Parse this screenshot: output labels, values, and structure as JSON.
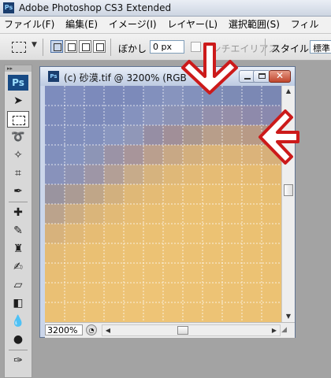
{
  "app": {
    "badge": "Ps",
    "title": "Adobe Photoshop CS3 Extended"
  },
  "menu": [
    "ファイル(F)",
    "編集(E)",
    "イメージ(I)",
    "レイヤー(L)",
    "選択範囲(S)",
    "フィル"
  ],
  "options": {
    "feather_label": "ぼかし :",
    "feather_value": "0 px",
    "antialias_label": "アンチエイリアス",
    "style_label": "スタイル :",
    "style_value": "標準"
  },
  "toolbox": {
    "logo": "Ps"
  },
  "document": {
    "badge": "Ps",
    "title": "(c) 砂漠.tif @ 3200% (RGB",
    "zoom": "3200%",
    "grid_colors": [
      [
        "#7d8cbd",
        "#7f8dbe",
        "#7c8abb",
        "#7b89ba",
        "#7c8aba",
        "#8290bd",
        "#8794be",
        "#8391bc",
        "#7f8db7",
        "#7d8bb5",
        "#7b88b4",
        "#7a87b3"
      ],
      [
        "#7e8cbc",
        "#7f8dbc",
        "#7c8aba",
        "#7e8cbb",
        "#8592be",
        "#8c96bd",
        "#8c93b6",
        "#8b90b2",
        "#938fac",
        "#958ea9",
        "#8e8aab",
        "#8a89ae"
      ],
      [
        "#7f8dbc",
        "#808ebc",
        "#8290bd",
        "#8996bf",
        "#9097b8",
        "#968ea4",
        "#a18f98",
        "#aa978f",
        "#b89e8a",
        "#bb9e86",
        "#b89a86",
        "#ad9387"
      ],
      [
        "#8290bd",
        "#8694bf",
        "#8d95b6",
        "#9b93a6",
        "#a8959a",
        "#ba9f8e",
        "#c8a885",
        "#d3af7d",
        "#dbb479",
        "#dcb478",
        "#dbb37a",
        "#d7b07a"
      ],
      [
        "#8892bb",
        "#8f93b3",
        "#9e96a6",
        "#b39f96",
        "#c7ab8a",
        "#d6b37e",
        "#dfb878",
        "#e3ba76",
        "#e6bc74",
        "#e7bc73",
        "#e6bb72",
        "#e5ba72"
      ],
      [
        "#9a949f",
        "#ab9b94",
        "#c0a688",
        "#d2b07e",
        "#dfb877",
        "#e4bb75",
        "#e7bd74",
        "#e9bf73",
        "#eac073",
        "#eabf72",
        "#e9bf72",
        "#e8be71"
      ],
      [
        "#bba38c",
        "#cdad82",
        "#dab57a",
        "#e2ba76",
        "#e7bd74",
        "#e9bf73",
        "#eac073",
        "#ebc173",
        "#ebc173",
        "#ebc072",
        "#eac072",
        "#eabf71"
      ],
      [
        "#d7b27c",
        "#e0b877",
        "#e6bc74",
        "#e9bf73",
        "#eac073",
        "#ebc173",
        "#ecc274",
        "#ecc274",
        "#ecc273",
        "#ebc173",
        "#ebc172",
        "#eac072"
      ],
      [
        "#e4bb75",
        "#e8be74",
        "#eac073",
        "#ebc174",
        "#ecc274",
        "#ecc274",
        "#edc375",
        "#ecc274",
        "#ecc274",
        "#ecc273",
        "#ebc173",
        "#ebc172"
      ],
      [
        "#e8be74",
        "#eac074",
        "#ebc174",
        "#ecc275",
        "#edc375",
        "#edc375",
        "#edc375",
        "#edc375",
        "#ecc274",
        "#ecc274",
        "#ecc273",
        "#ebc173"
      ],
      [
        "#eac074",
        "#ebc174",
        "#ecc275",
        "#edc375",
        "#edc376",
        "#eec476",
        "#edc375",
        "#edc375",
        "#edc375",
        "#ecc274",
        "#ecc274",
        "#ecc273"
      ],
      [
        "#ebc174",
        "#ecc275",
        "#edc375",
        "#edc376",
        "#eec476",
        "#eec476",
        "#eec476",
        "#edc375",
        "#edc375",
        "#edc375",
        "#ecc274",
        "#ecc274"
      ]
    ]
  },
  "annotations": {
    "arrow_color": "#cc1a1a"
  }
}
